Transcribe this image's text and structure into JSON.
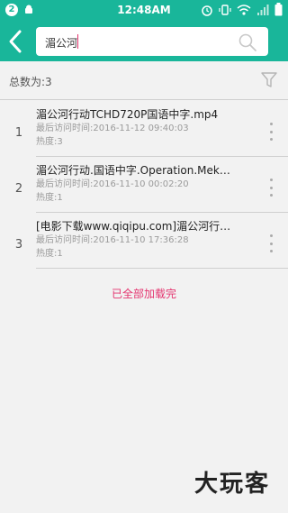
{
  "status_bar": {
    "notification_badge": "2",
    "time": "12:48AM"
  },
  "header": {
    "search_value": "湄公河",
    "back_icon": "back-arrow",
    "search_icon": "magnifier"
  },
  "summary": {
    "total_label": "总数为:3",
    "filter_icon": "funnel"
  },
  "results": [
    {
      "index": "1",
      "title": "湄公河行动TCHD720P国语中字.mp4",
      "last_visit": "最后访问时间:2016-11-12 09:40:03",
      "heat": "热度:3"
    },
    {
      "index": "2",
      "title": "湄公河行动.国语中字.Operation.Mek…",
      "last_visit": "最后访问时间:2016-11-10 00:02:20",
      "heat": "热度:1"
    },
    {
      "index": "3",
      "title": "[电影下载www.qiqipu.com]湄公河行…",
      "last_visit": "最后访问时间:2016-11-10 17:36:28",
      "heat": "热度:1"
    }
  ],
  "footer": {
    "all_loaded": "已全部加载完"
  },
  "watermark": "大玩客",
  "colors": {
    "accent": "#19b69a",
    "highlight": "#e4336e"
  }
}
